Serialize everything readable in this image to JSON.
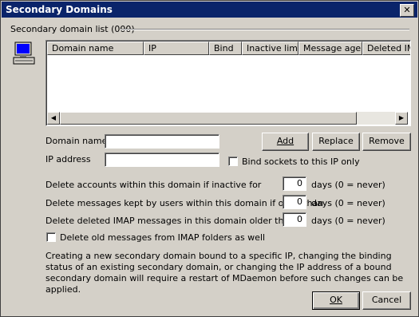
{
  "window": {
    "title": "Secondary Domains",
    "close_glyph": "✕"
  },
  "group": {
    "label": "Secondary domain list (000)"
  },
  "list": {
    "columns": [
      "Domain name",
      "IP",
      "Bind",
      "Inactive limit",
      "Message age",
      "Deleted IM"
    ],
    "rows": []
  },
  "form": {
    "domain_name_label": "Domain name",
    "domain_name_value": "",
    "ip_address_label": "IP address",
    "ip_address_value": "",
    "bind_label": "Bind sockets to this IP only",
    "bind_checked": false
  },
  "buttons": {
    "add": "Add",
    "replace": "Replace",
    "remove": "Remove",
    "ok": "OK",
    "cancel": "Cancel"
  },
  "settings": [
    {
      "label": "Delete accounts within this domain if inactive for",
      "value": "0",
      "unit": "days (0 = never)"
    },
    {
      "label": "Delete messages kept by users within this domain if older than",
      "value": "0",
      "unit": "days (0 = never)"
    },
    {
      "label": "Delete deleted IMAP messages in this domain older than",
      "value": "0",
      "unit": "days (0 = never)"
    }
  ],
  "imap_option": {
    "label": "Delete old messages from IMAP folders as well",
    "checked": false
  },
  "note": "Creating a new secondary domain bound to a specific IP, changing the binding status of an existing secondary domain, or changing the IP address of a bound secondary domain will require a restart of MDaemon before such changes can be applied."
}
